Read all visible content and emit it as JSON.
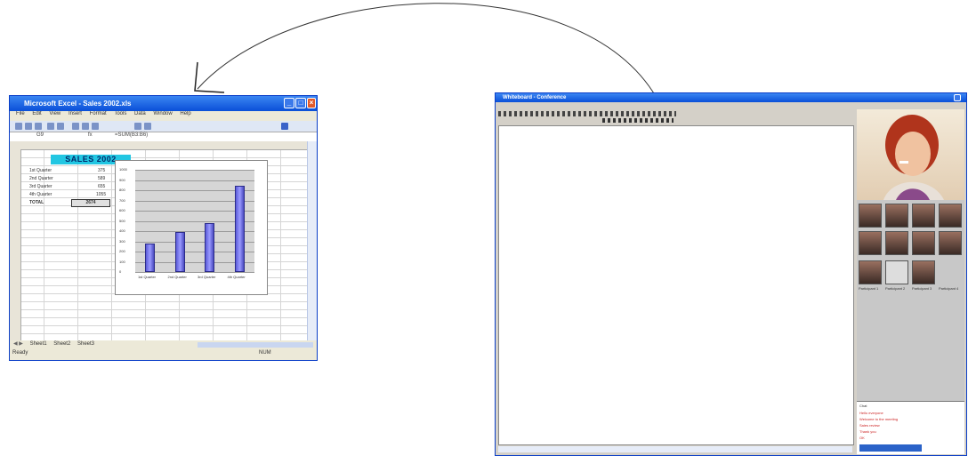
{
  "excel": {
    "title": "Microsoft Excel - Sales 2002.xls",
    "menu": [
      "File",
      "Edit",
      "View",
      "Insert",
      "Format",
      "Tools",
      "Data",
      "Window",
      "Help"
    ],
    "name_box": "G9",
    "formula": "=SUM(B3:B6)",
    "sales_header": "SALES 2002",
    "rows": [
      {
        "label": "1st Quarter",
        "value": "375"
      },
      {
        "label": "2nd Quarter",
        "value": "589"
      },
      {
        "label": "3rd Quarter",
        "value": "655"
      },
      {
        "label": "4th Quarter",
        "value": "1055"
      }
    ],
    "total_label": "TOTAL",
    "total_value": "2674",
    "sheet_tabs": [
      "Sheet1",
      "Sheet2",
      "Sheet3"
    ],
    "status": "Ready",
    "status_right": "NUM"
  },
  "chart_data": {
    "type": "bar",
    "categories": [
      "1st Quarter",
      "2nd Quarter",
      "3rd Quarter",
      "4th Quarter"
    ],
    "values": [
      275,
      390,
      480,
      840
    ],
    "ylim": [
      0,
      1000
    ],
    "yticks": [
      "0",
      "100",
      "200",
      "300",
      "400",
      "500",
      "600",
      "700",
      "800",
      "900",
      "1000"
    ],
    "title": "",
    "xlabel": "",
    "ylabel": "",
    "bar_color": "#8a8af0"
  },
  "app": {
    "title": "Whiteboard - Conference",
    "video_labels": [
      "Participant 1",
      "Participant 2",
      "Participant 3",
      "Participant 4"
    ],
    "chat_title": "Chat",
    "chat_lines": [
      "Hello everyone",
      "Welcome to the meeting",
      "Sales review",
      "Thank you",
      "OK"
    ]
  },
  "colors": {
    "title_blue": "#0a4fd8",
    "accent_cyan": "#22c6e2"
  }
}
